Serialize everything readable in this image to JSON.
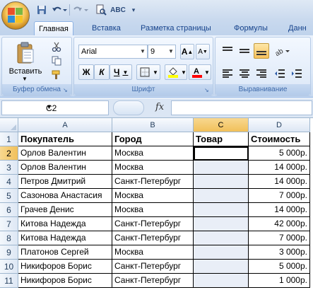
{
  "app": {
    "quick_access": {
      "spell_label": "ABC",
      "more": "▾"
    }
  },
  "tabs": [
    "Главная",
    "Вставка",
    "Разметка страницы",
    "Формулы",
    "Данн"
  ],
  "ribbon": {
    "clipboard": {
      "paste_label": "Вставить",
      "group_label": "Буфер обмена"
    },
    "font": {
      "font_name": "Arial",
      "font_size": "9",
      "grow_label": "A",
      "shrink_label": "A",
      "bold": "Ж",
      "italic": "К",
      "underline": "Ч",
      "fill_color": "#ffff00",
      "font_color": "#ff0000",
      "group_label": "Шрифт"
    },
    "alignment": {
      "group_label": "Выравнивание"
    }
  },
  "formula_bar": {
    "name_box": "C2",
    "fx_label": "fx",
    "formula": ""
  },
  "grid": {
    "columns": [
      "A",
      "B",
      "C",
      "D"
    ],
    "rows": [
      "1",
      "2",
      "3",
      "4",
      "5",
      "6",
      "7",
      "8",
      "9",
      "10",
      "11"
    ],
    "selected_column": "C",
    "header_row": [
      "Покупатель",
      "Город",
      "Товар",
      "Стоимость"
    ],
    "data": [
      [
        "Орлов Валентин",
        "Москва",
        "",
        "5 000р."
      ],
      [
        "Орлов Валентин",
        "Москва",
        "",
        "14 000р."
      ],
      [
        "Петров Дмитрий",
        "Санкт-Петербург",
        "",
        "14 000р."
      ],
      [
        "Сазонова Анастасия",
        "Москва",
        "",
        "7 000р."
      ],
      [
        "Грачев Денис",
        "Москва",
        "",
        "14 000р."
      ],
      [
        "Китова Надежда",
        "Санкт-Петербург",
        "",
        "42 000р."
      ],
      [
        "Китова Надежда",
        "Санкт-Петербург",
        "",
        "7 000р."
      ],
      [
        "Платонов Сергей",
        "Москва",
        "",
        "3 000р."
      ],
      [
        "Никифоров Борис",
        "Санкт-Петербург",
        "",
        "5 000р."
      ],
      [
        "Никифоров Борис",
        "Санкт-Петербург",
        "",
        "1 000р."
      ]
    ]
  }
}
